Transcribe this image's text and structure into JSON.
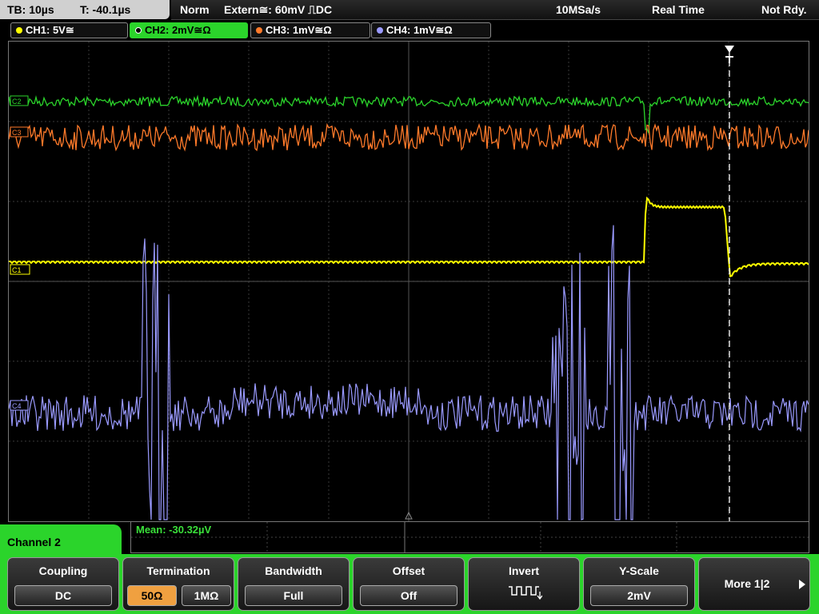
{
  "header": {
    "timebase": "TB: 10µs",
    "trigger_time": "T: -40.1µs",
    "mode": "Norm",
    "trigger_source": "Extern≅: 60mV ⎍DC",
    "sample_rate": "10MSa/s",
    "acquisition": "Real Time",
    "status": "Not Rdy."
  },
  "channels": [
    {
      "label": "CH1: 5V≅",
      "color": "#ffff00"
    },
    {
      "label": "CH2: 2mV≅Ω",
      "color": "#2bd42b"
    },
    {
      "label": "CH3: 1mV≅Ω",
      "color": "#ff7a2a"
    },
    {
      "label": "CH4: 1mV≅Ω",
      "color": "#9a9aff"
    }
  ],
  "markers": {
    "c2": "C2",
    "c3": "C3",
    "c1": "C1",
    "c4": "C4"
  },
  "measurement": "Mean: -30.32µV",
  "menu_title": "Channel 2",
  "softkeys": {
    "coupling": {
      "title": "Coupling",
      "value": "DC"
    },
    "termination": {
      "title": "Termination",
      "opt1": "50Ω",
      "opt2": "1MΩ"
    },
    "bandwidth": {
      "title": "Bandwidth",
      "value": "Full"
    },
    "offset": {
      "title": "Offset",
      "value": "Off"
    },
    "invert": {
      "title": "Invert"
    },
    "yscale": {
      "title": "Y-Scale",
      "value": "2mV"
    },
    "more": {
      "label": "More 1|2"
    }
  }
}
